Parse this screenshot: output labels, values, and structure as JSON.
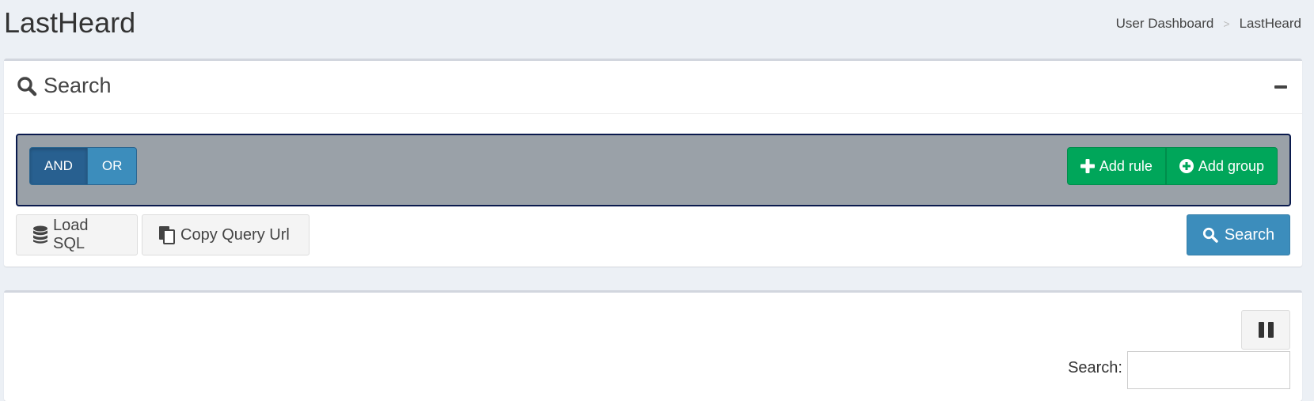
{
  "header": {
    "title": "LastHeard",
    "breadcrumb": [
      {
        "label": "User Dashboard"
      },
      {
        "label": "LastHeard"
      }
    ],
    "separator": ">"
  },
  "search_box": {
    "title": "Search",
    "icon": "search-icon",
    "collapse_icon": "minus-icon",
    "query_builder": {
      "conditions": [
        "AND",
        "OR"
      ],
      "selected_condition": "AND",
      "add_rule_label": "Add rule",
      "add_group_label": "Add group"
    },
    "load_sql_label": "Load SQL",
    "copy_url_label": "Copy Query Url",
    "search_button_label": "Search"
  },
  "results_box": {
    "pause_icon": "pause-icon",
    "search_label": "Search:",
    "search_value": ""
  },
  "colors": {
    "background": "#ecf0f5",
    "primary": "#3c8dbc",
    "primary_active": "#286090",
    "success": "#00a65a",
    "rule_group_bg": "#9aa1a8",
    "rule_group_border": "#0a1a4d"
  }
}
